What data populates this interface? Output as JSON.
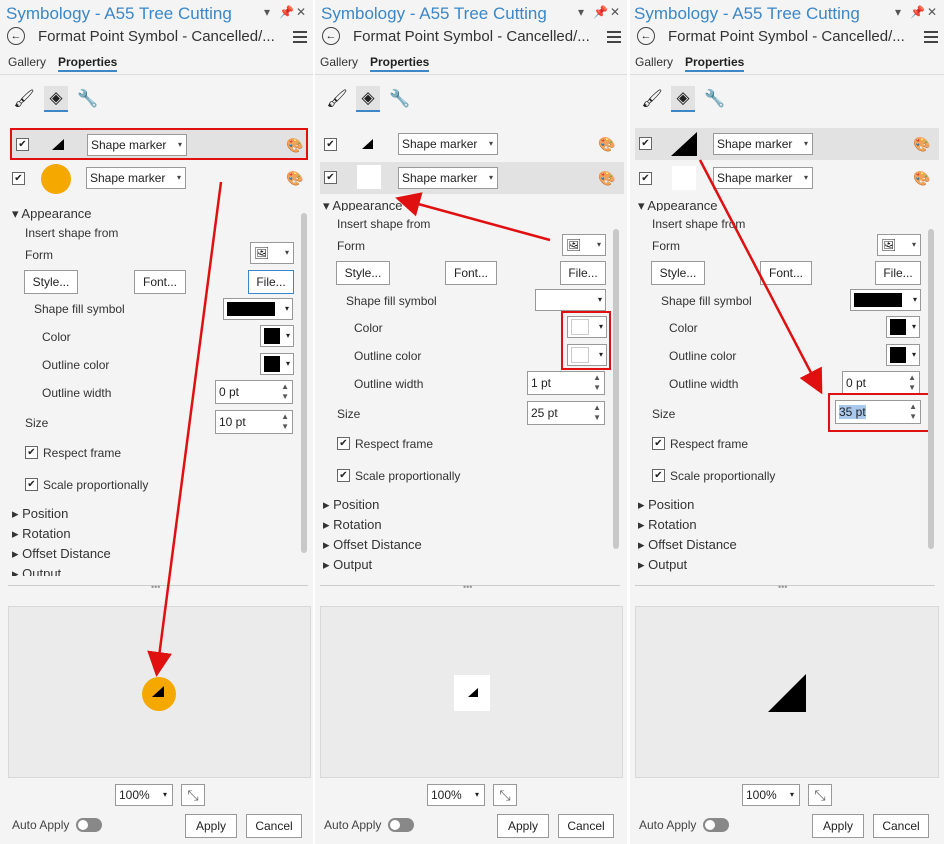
{
  "window_title": "Symbology - A55 Tree Cutting",
  "subtitle": "Format Point Symbol - Cancelled/...",
  "tabs": [
    "Gallery",
    "Properties"
  ],
  "layer_dropdown_label": "Shape marker",
  "appearance": "Appearance",
  "insert_shape_from": "Insert shape from",
  "form": "Form",
  "style_btn": "Style...",
  "font_btn": "Font...",
  "file_btn": "File...",
  "shape_fill_symbol": "Shape fill symbol",
  "color": "Color",
  "outline_color": "Outline color",
  "outline_width": "Outline width",
  "size": "Size",
  "respect_frame": "Respect frame",
  "scale_proportionally": "Scale proportionally",
  "position": "Position",
  "rotation": "Rotation",
  "offset_distance": "Offset Distance",
  "output": "Output",
  "zoom": "100%",
  "auto_apply": "Auto Apply",
  "apply": "Apply",
  "cancel": "Cancel",
  "panels": [
    {
      "outline_width_value": "0 pt",
      "size_value": "10 pt",
      "fill_color": "#000000",
      "color_value": "#000000",
      "outline_value": "#000000",
      "marker_color": "#f5a800"
    },
    {
      "outline_width_value": "1 pt",
      "size_value": "25 pt",
      "fill_color": "#ffffff",
      "color_value": "#ffffff",
      "outline_value": "#ffffff",
      "marker_color": "#ffffff"
    },
    {
      "outline_width_value": "0 pt",
      "size_value": "35 pt",
      "fill_color": "#000000",
      "color_value": "#000000",
      "outline_value": "#000000",
      "marker_color": "#ffffff"
    }
  ],
  "colors": {
    "accent": "#3b87c8",
    "highlight": "#e01010",
    "marker_orange": "#f5a800"
  },
  "icons": [
    "back-arrow-icon",
    "pin-icon",
    "close-icon",
    "menu-icon",
    "brush-icon",
    "layers-icon",
    "wrench-icon",
    "color-palette-icon",
    "triangle-marker-icon",
    "flower-marker-icon",
    "shape-picker-icon",
    "fit-to-window-icon"
  ]
}
